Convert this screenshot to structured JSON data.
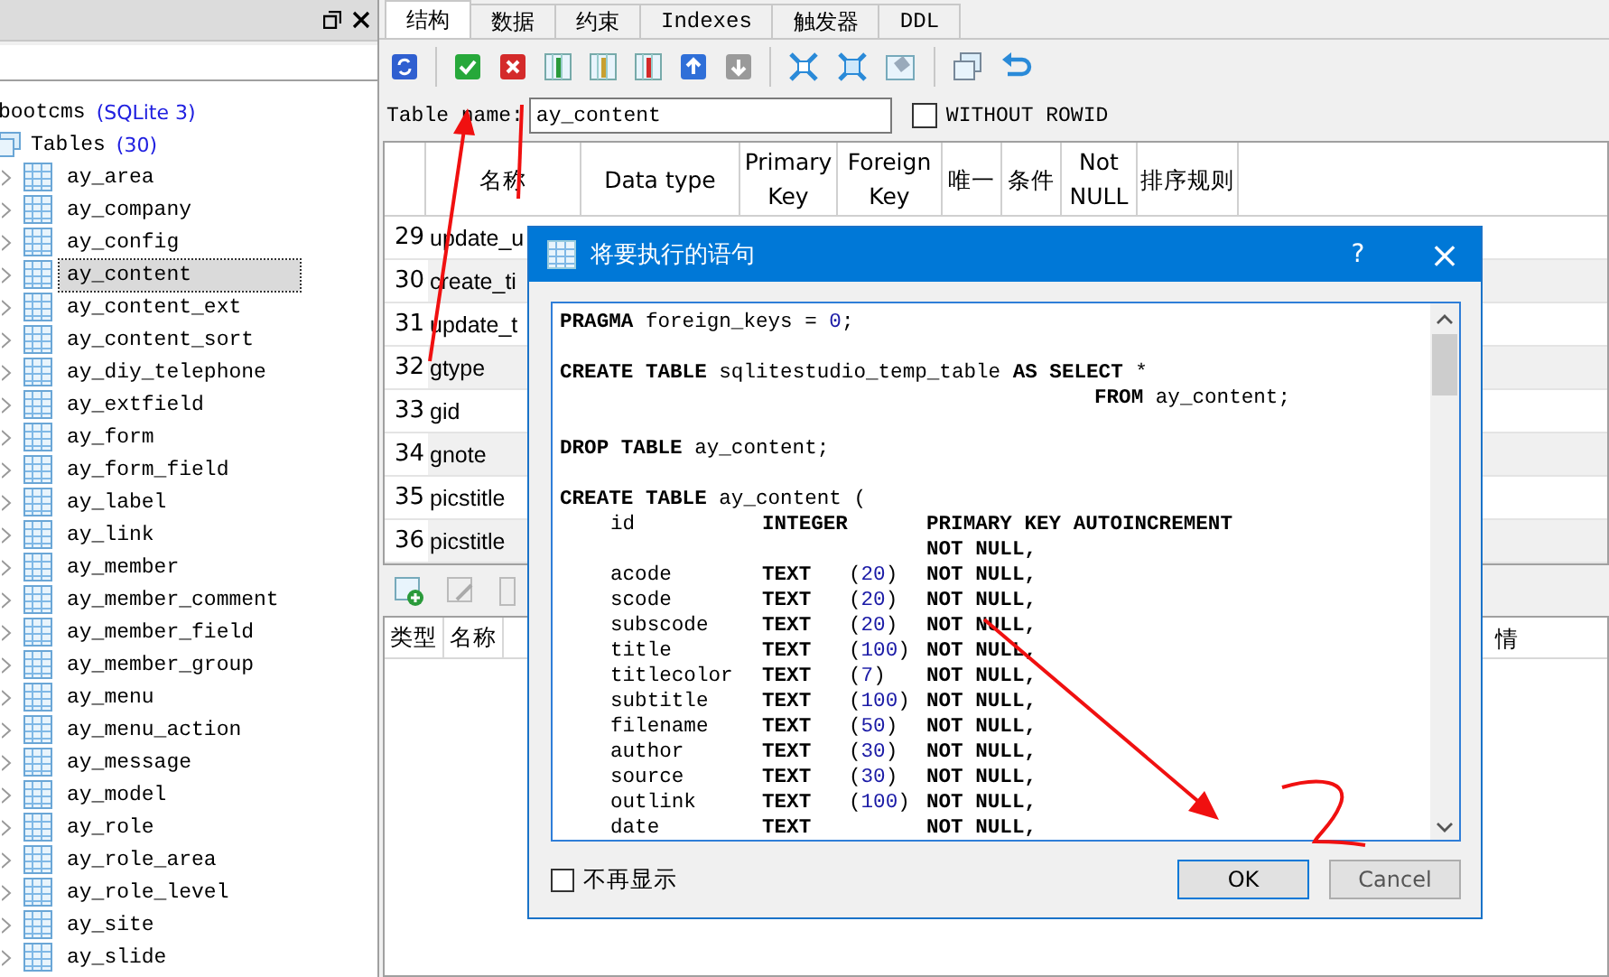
{
  "left_panel": {
    "tree": {
      "label": "bootcms",
      "meta": "(SQLite 3)",
      "children": [
        {
          "label": "Tables",
          "meta": "(30)",
          "children": [
            {
              "label": "ay_area",
              "selected": false
            },
            {
              "label": "ay_company",
              "selected": false
            },
            {
              "label": "ay_config",
              "selected": false
            },
            {
              "label": "ay_content",
              "selected": true
            },
            {
              "label": "ay_content_ext",
              "selected": false
            },
            {
              "label": "ay_content_sort",
              "selected": false
            },
            {
              "label": "ay_diy_telephone",
              "selected": false
            },
            {
              "label": "ay_extfield",
              "selected": false
            },
            {
              "label": "ay_form",
              "selected": false
            },
            {
              "label": "ay_form_field",
              "selected": false
            },
            {
              "label": "ay_label",
              "selected": false
            },
            {
              "label": "ay_link",
              "selected": false
            },
            {
              "label": "ay_member",
              "selected": false
            },
            {
              "label": "ay_member_comment",
              "selected": false
            },
            {
              "label": "ay_member_field",
              "selected": false
            },
            {
              "label": "ay_member_group",
              "selected": false
            },
            {
              "label": "ay_menu",
              "selected": false
            },
            {
              "label": "ay_menu_action",
              "selected": false
            },
            {
              "label": "ay_message",
              "selected": false
            },
            {
              "label": "ay_model",
              "selected": false
            },
            {
              "label": "ay_role",
              "selected": false
            },
            {
              "label": "ay_role_area",
              "selected": false
            },
            {
              "label": "ay_role_level",
              "selected": false
            },
            {
              "label": "ay_site",
              "selected": false
            },
            {
              "label": "ay_slide",
              "selected": false
            }
          ]
        }
      ]
    }
  },
  "tabs": [
    {
      "label": "结构",
      "selected": true
    },
    {
      "label": "数据",
      "selected": false
    },
    {
      "label": "约束",
      "selected": false
    },
    {
      "label": "Indexes",
      "selected": false
    },
    {
      "label": "触发器",
      "selected": false
    },
    {
      "label": "DDL",
      "selected": false
    }
  ],
  "table_name": {
    "label": "Table name:",
    "value": "ay_content"
  },
  "without_rowid": {
    "label": "WITHOUT ROWID",
    "checked": false
  },
  "columns_grid": {
    "columns": [
      "名称",
      "Data type",
      "Primary Key",
      "Foreign Key",
      "唯一",
      "条件",
      "Not NULL",
      "排序规则"
    ],
    "rows": [
      {
        "number": "29",
        "name": "update_u"
      },
      {
        "number": "30",
        "name": "create_ti"
      },
      {
        "number": "31",
        "name": "update_t"
      },
      {
        "number": "32",
        "name": "gtype"
      },
      {
        "number": "33",
        "name": "gid"
      },
      {
        "number": "34",
        "name": "gnote"
      },
      {
        "number": "35",
        "name": "picstitle"
      },
      {
        "number": "36",
        "name": "picstitle"
      }
    ]
  },
  "constraints_grid": {
    "columns": [
      "类型",
      "名称"
    ],
    "column_last": "情"
  },
  "dialog": {
    "title": "将要执行的语句",
    "help": "?",
    "close": "×",
    "statements": [
      {
        "lines": [
          {
            "kind": "statement",
            "segments": [
              {
                "kind": "kw",
                "text": "PRAGMA"
              },
              {
                "kind": "tx",
                "text": " foreign_keys = "
              },
              {
                "kind": "num",
                "text": "0"
              },
              {
                "kind": "tx",
                "text": ";"
              }
            ]
          }
        ]
      },
      {
        "lines": [
          {
            "kind": "statement",
            "segments": [
              {
                "kind": "kw",
                "text": "CREATE TABLE"
              },
              {
                "kind": "tx",
                "text": " sqlitestudio_temp_table "
              },
              {
                "kind": "kw",
                "text": "AS SELECT"
              },
              {
                "kind": "tx",
                "text": " *"
              }
            ]
          },
          {
            "kind": "continuation",
            "segments": [
              {
                "kind": "kw",
                "text": "FROM"
              },
              {
                "kind": "tx",
                "text": " ay_content;"
              }
            ]
          }
        ]
      },
      {
        "lines": [
          {
            "kind": "statement",
            "segments": [
              {
                "kind": "kw",
                "text": "DROP TABLE"
              },
              {
                "kind": "tx",
                "text": " ay_content;"
              }
            ]
          }
        ]
      },
      {
        "lines": [
          {
            "kind": "statement",
            "segments": [
              {
                "kind": "kw",
                "text": "CREATE TABLE"
              },
              {
                "kind": "tx",
                "text": " ay_content ("
              }
            ]
          },
          {
            "kind": "column",
            "name": "id",
            "type": "INTEGER",
            "constraint": "PRIMARY KEY AUTOINCREMENT"
          },
          {
            "kind": "constraint",
            "constraint": "NOT NULL,"
          },
          {
            "kind": "column",
            "name": "acode",
            "type": "TEXT",
            "size": "(20)",
            "constraint": "NOT NULL,"
          },
          {
            "kind": "column",
            "name": "scode",
            "type": "TEXT",
            "size": "(20)",
            "constraint": "NOT NULL,"
          },
          {
            "kind": "column",
            "name": "subscode",
            "type": "TEXT",
            "size": "(20)",
            "constraint": "NOT NULL,"
          },
          {
            "kind": "column",
            "name": "title",
            "type": "TEXT",
            "size": "(100)",
            "constraint": "NOT NULL,"
          },
          {
            "kind": "column",
            "name": "titlecolor",
            "type": "TEXT",
            "size": "(7)",
            "constraint": "NOT NULL,"
          },
          {
            "kind": "column",
            "name": "subtitle",
            "type": "TEXT",
            "size": "(100)",
            "constraint": "NOT NULL,"
          },
          {
            "kind": "column",
            "name": "filename",
            "type": "TEXT",
            "size": "(50)",
            "constraint": "NOT NULL,"
          },
          {
            "kind": "column",
            "name": "author",
            "type": "TEXT",
            "size": "(30)",
            "constraint": "NOT NULL,"
          },
          {
            "kind": "column",
            "name": "source",
            "type": "TEXT",
            "size": "(30)",
            "constraint": "NOT NULL,"
          },
          {
            "kind": "column",
            "name": "outlink",
            "type": "TEXT",
            "size": "(100)",
            "constraint": "NOT NULL,"
          },
          {
            "kind": "column",
            "name": "date",
            "type": "TEXT",
            "constraint": "NOT NULL,"
          }
        ]
      }
    ],
    "dont_show": {
      "label": "不再显示",
      "checked": false
    },
    "buttons": [
      "OK",
      "Cancel"
    ]
  }
}
